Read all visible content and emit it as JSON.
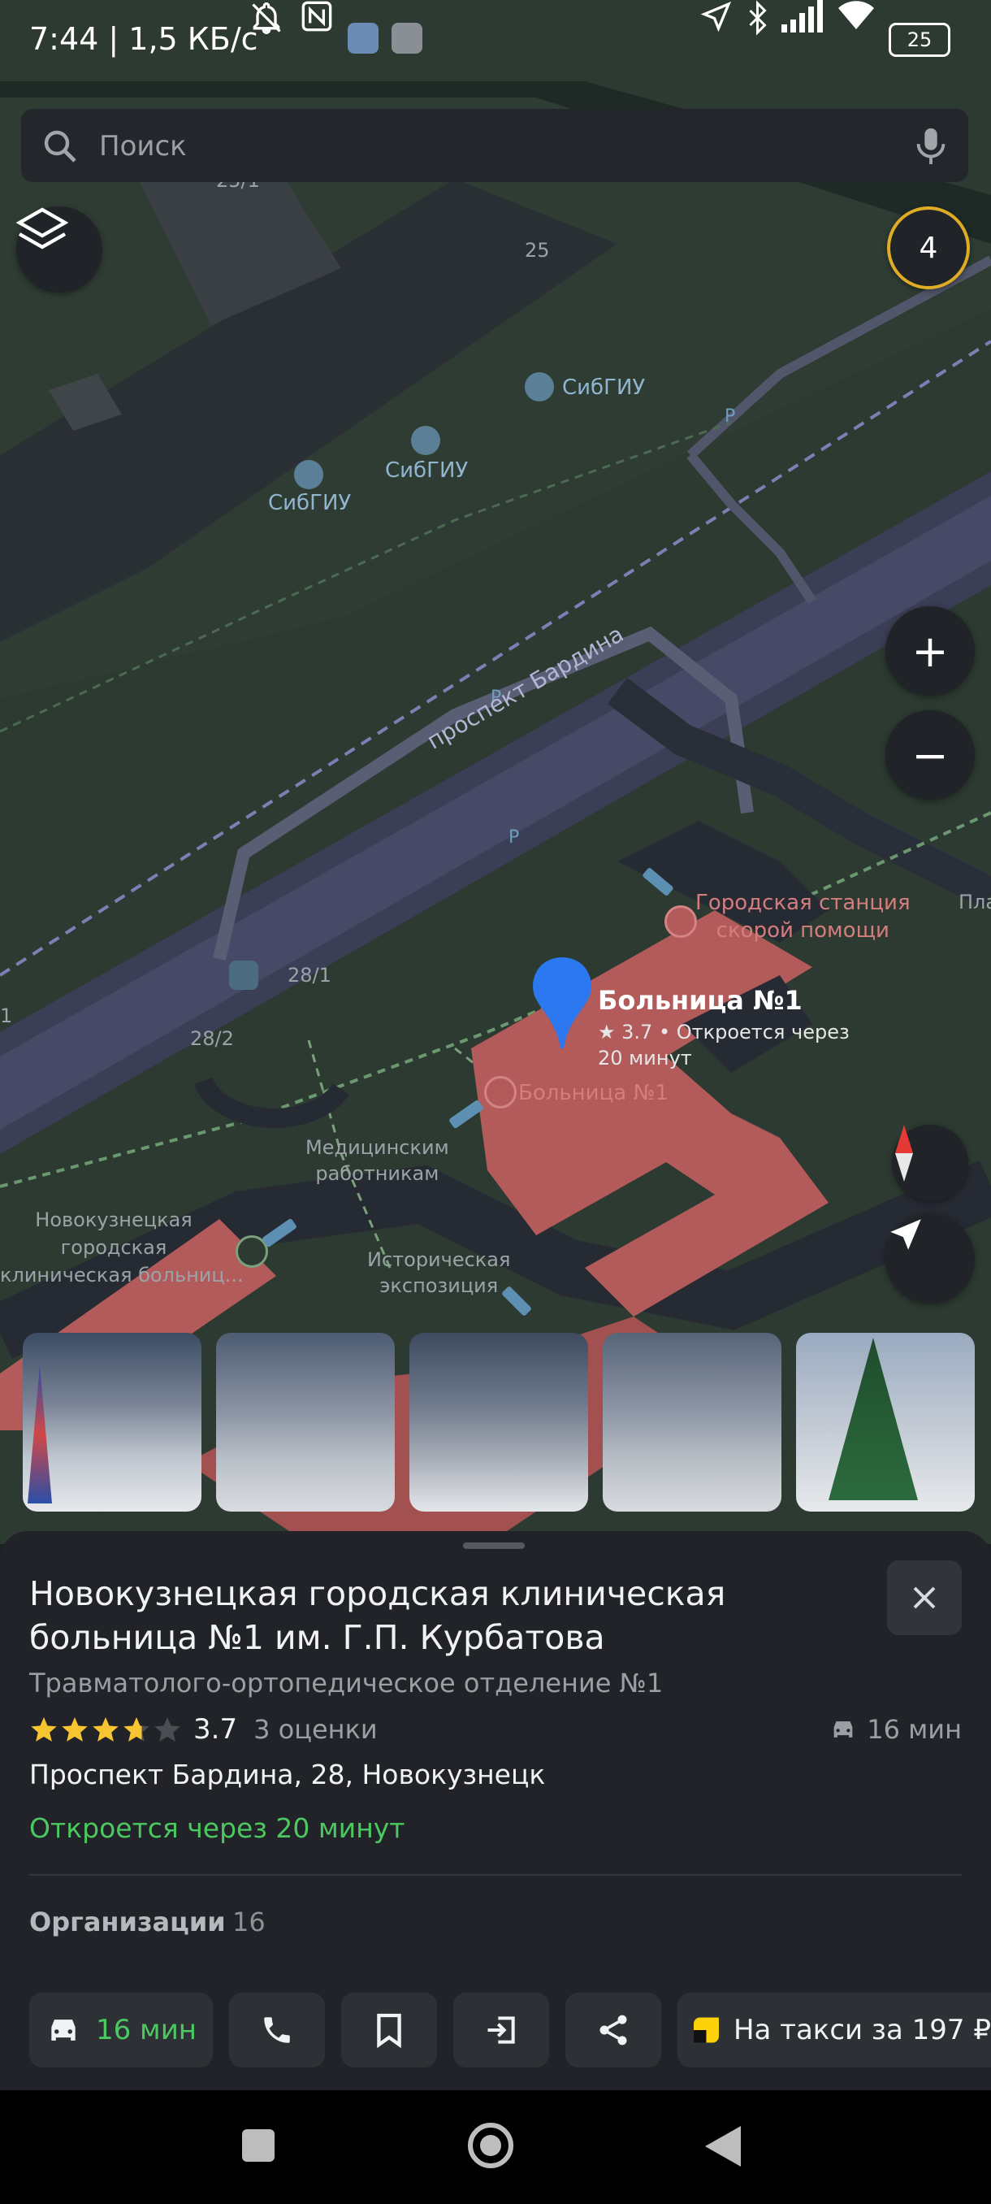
{
  "status_bar": {
    "time": "7:44 | 1,5 КБ/с",
    "battery": "25"
  },
  "search": {
    "placeholder": "Поиск"
  },
  "map": {
    "layers_icon": "layers-icon",
    "profile_badge": "4",
    "labels": {
      "building_25_1": "25/1",
      "building_25": "25",
      "sibgiu_1": "СибГИУ",
      "sibgiu_2": "СибГИУ",
      "sibgiu_3": "СибГИУ",
      "parking": "P",
      "street": "проспект Бардина",
      "ambulance": "Городская станция\nскорой помощи",
      "building_28_1": "28/1",
      "building_28_2": "28/2",
      "hospital_small": "Больница №1",
      "monument_1": "Медицинским\nработникам",
      "monument_2": "Историческая\nэкспозиция",
      "left_hospital": "Новокузнецкая\nгородская\nклиническая больниц...",
      "edge_left": "1",
      "edge_right": "Пла"
    },
    "pin": {
      "title": "Больница №1",
      "rating": "★ 3.7 • Откроется через",
      "rating_line2": "20 минут"
    },
    "zoom_in": "+",
    "zoom_out": "−"
  },
  "place": {
    "title": "Новокузнецкая городская клиническая больница №1 им. Г.П. Курбатова",
    "subtitle": "Травматолого-ортопедическое отделение №1",
    "rating": "3.7",
    "rating_fraction": 0.74,
    "ratings_count": "3 оценки",
    "drive_time": "16 мин",
    "address": "Проспект Бардина, 28, Новокузнецк",
    "open_status": "Откроется через 20 минут",
    "organizations_label": "Организации",
    "organizations_count": "16"
  },
  "actions": {
    "route_time": "16 мин",
    "taxi": "На такси за 197 ₽"
  },
  "colors": {
    "accent_green": "#4cc860",
    "pin_blue": "#2b78f0",
    "hospital_red": "#b35a5a",
    "star_yellow": "#f7c531"
  }
}
